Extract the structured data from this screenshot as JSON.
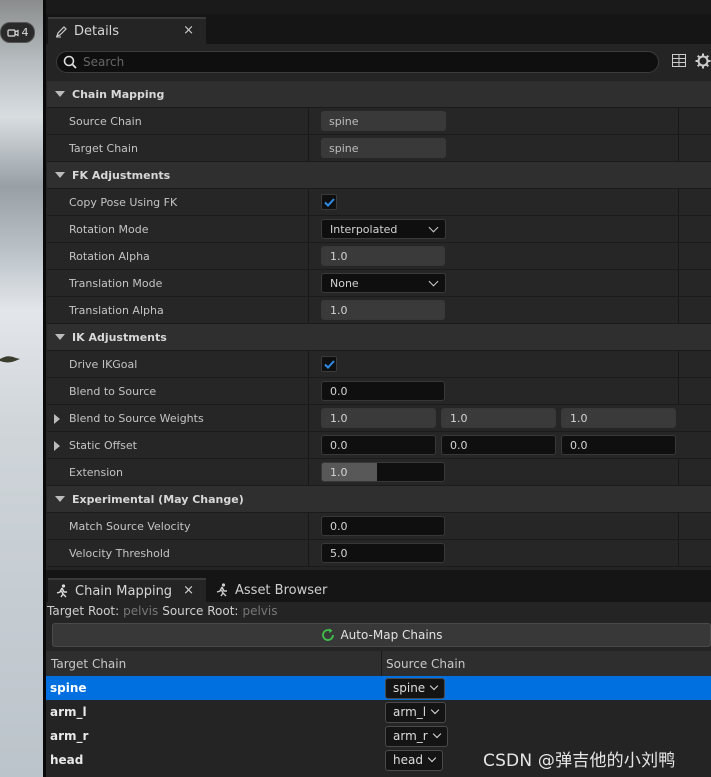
{
  "viewport": {
    "camera_speed": "4"
  },
  "details_tab": {
    "title": "Details",
    "close": "×"
  },
  "search": {
    "placeholder": "Search"
  },
  "sections": {
    "chain_mapping": {
      "title": "Chain Mapping",
      "source_chain": {
        "label": "Source Chain",
        "value": "spine"
      },
      "target_chain": {
        "label": "Target Chain",
        "value": "spine"
      }
    },
    "fk": {
      "title": "FK Adjustments",
      "copy_pose": {
        "label": "Copy Pose Using FK",
        "checked": true
      },
      "rotation_mode": {
        "label": "Rotation Mode",
        "value": "Interpolated"
      },
      "rotation_alpha": {
        "label": "Rotation Alpha",
        "value": "1.0"
      },
      "translation_mode": {
        "label": "Translation Mode",
        "value": "None"
      },
      "translation_alpha": {
        "label": "Translation Alpha",
        "value": "1.0"
      }
    },
    "ik": {
      "title": "IK Adjustments",
      "drive_ikgoal": {
        "label": "Drive IKGoal",
        "checked": true
      },
      "blend_to_source": {
        "label": "Blend to Source",
        "value": "0.0"
      },
      "blend_weights": {
        "label": "Blend to Source Weights",
        "values": [
          "1.0",
          "1.0",
          "1.0"
        ]
      },
      "static_offset": {
        "label": "Static Offset",
        "values": [
          "0.0",
          "0.0",
          "0.0"
        ]
      },
      "extension": {
        "label": "Extension",
        "value": "1.0",
        "fill_fraction": 0.45
      }
    },
    "experimental": {
      "title": "Experimental (May Change)",
      "match_velocity": {
        "label": "Match Source Velocity",
        "value": "0.0"
      },
      "velocity_threshold": {
        "label": "Velocity Threshold",
        "value": "5.0"
      }
    }
  },
  "bottom_tabs": {
    "chain_mapping": "Chain Mapping",
    "asset_browser": "Asset Browser",
    "close": "×"
  },
  "roots": {
    "target_label": "Target Root:",
    "target_value": "pelvis",
    "source_label": "Source Root:",
    "source_value": "pelvis"
  },
  "automap": {
    "label": "Auto-Map Chains"
  },
  "table": {
    "headers": [
      "Target Chain",
      "Source Chain"
    ],
    "rows": [
      {
        "target": "spine",
        "source": "spine",
        "selected": true
      },
      {
        "target": "arm_l",
        "source": "arm_l",
        "selected": false
      },
      {
        "target": "arm_r",
        "source": "arm_r",
        "selected": false
      },
      {
        "target": "head",
        "source": "head",
        "selected": false
      }
    ]
  },
  "watermark": "CSDN @弹吉他的小刘鸭",
  "colors": {
    "selection": "#0070e0",
    "checkmark": "#2f8be6",
    "automap_icon": "#3fc04a"
  }
}
